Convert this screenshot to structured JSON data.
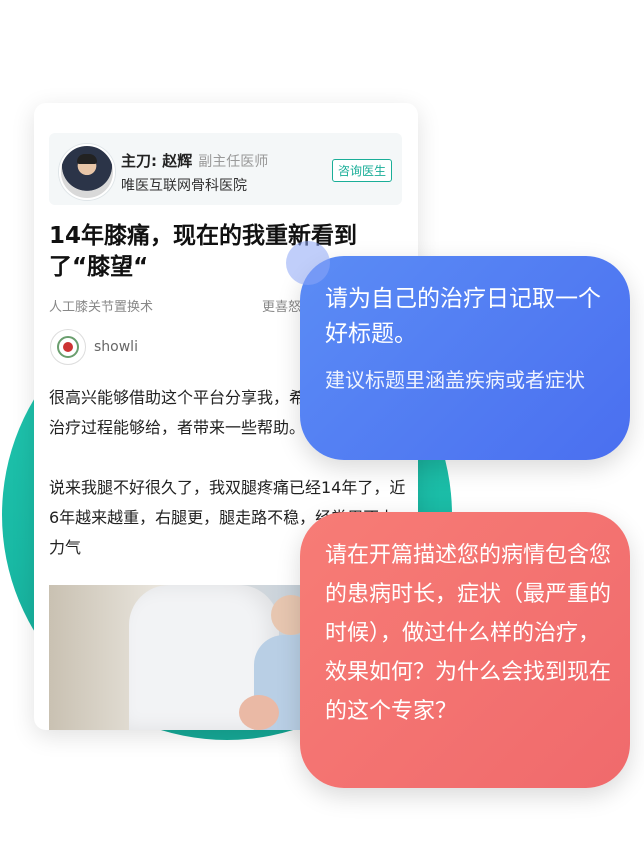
{
  "doctor": {
    "label": "主刀: ",
    "name": "赵辉",
    "title": "副主任医师",
    "hospital": "唯医互联网骨科医院",
    "consult_button": "咨询医生"
  },
  "article": {
    "title": "14年膝痛，现在的我重新看到了“膝望“",
    "tag": "人工膝关节置换术",
    "tag_right": "更喜怒",
    "author": "showli",
    "paragraphs": [
      "很高兴能够借助这个平台分享我，希望我的故事和治疗过程能够给，者带来一些帮助。",
      "说来我腿不好很久了，我双腿疼痛已经14年了，近6年越来越重，右腿更，腿走路不稳，经常用不上力气"
    ]
  },
  "tips": {
    "title_tip": "请为自己的治疗日记取一个好标题。",
    "title_sub": "建议标题里涵盖疾病或者症状",
    "intro_tip": "请在开篇描述您的病情包含您的患病时长，症状（最严重的时候），做过什么样的治疗，效果如何？为什么会找到现在的这个专家？"
  },
  "colors": {
    "teal": "#1aae98",
    "blue_bubble": "#4a6ff0",
    "red_bubble": "#f06a6c"
  }
}
